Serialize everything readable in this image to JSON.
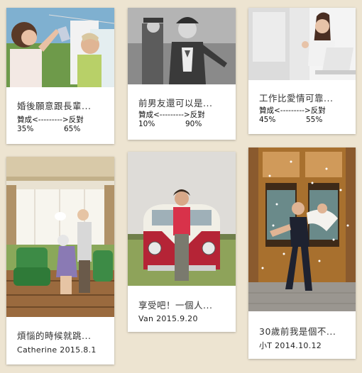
{
  "posts": [
    {
      "title": "婚後願意跟長輩...",
      "type": "poll",
      "labels": "贊成<--------->反對",
      "agree": "35%",
      "disagree": "65%",
      "photo_icon": "couple-with-mother-laundry-photo"
    },
    {
      "title": "前男友還可以是...",
      "type": "poll",
      "labels": "贊成<--------->反對",
      "agree": "10%",
      "disagree": "90%",
      "photo_icon": "bw-couple-walking-photo"
    },
    {
      "title": "工作比愛情可靠...",
      "type": "poll",
      "labels": "贊成<--------->反對",
      "agree": "45%",
      "disagree": "55%",
      "photo_icon": "woman-with-laptop-photo"
    },
    {
      "title": "煩惱的時候就跳...",
      "type": "story",
      "byline": "Catherine 2015.8.1",
      "photo_icon": "elderly-couple-dancing-photo"
    },
    {
      "title": "享受吧！一個人...",
      "type": "story",
      "byline": "Van 2015.9.20",
      "photo_icon": "man-with-red-van-photo"
    },
    {
      "title": "30歲前我是個不...",
      "type": "story",
      "byline": "小T  2014.10.12",
      "photo_icon": "wedding-couple-confetti-photo"
    }
  ]
}
